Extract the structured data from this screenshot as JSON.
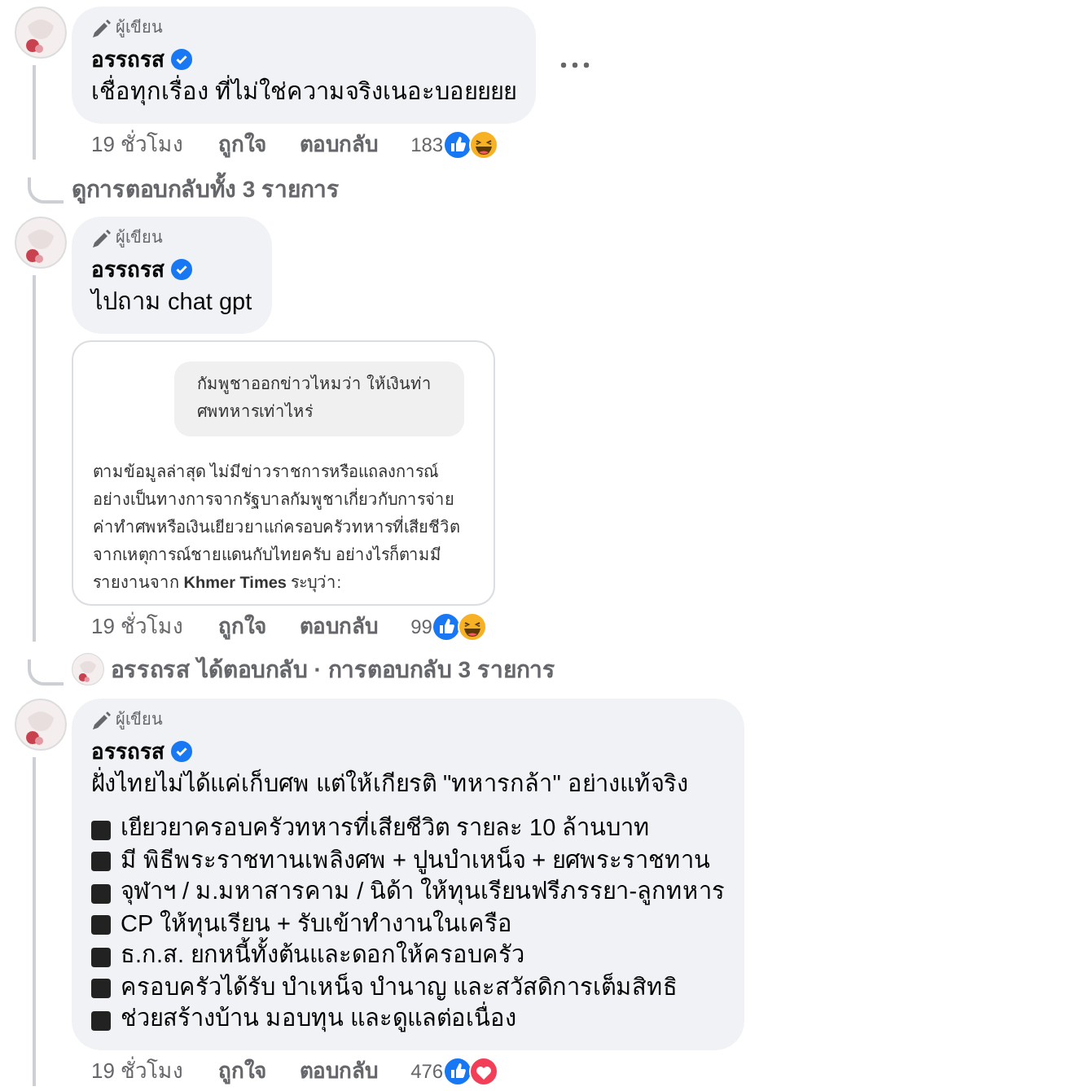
{
  "comments": [
    {
      "badge": "ผู้เขียน",
      "author": "อรรถรส",
      "verified": true,
      "text": "เชื่อทุกเรื่อง ที่ไม่ใช่ความจริงเนอะบอยยยย",
      "more_menu": true,
      "time": "19 ชั่วโมง",
      "like": "ถูกใจ",
      "reply": "ตอบกลับ",
      "reaction_count": "183",
      "reactions": [
        {
          "kind": "like"
        },
        {
          "kind": "haha"
        }
      ],
      "thread": {
        "kind": "link",
        "text": "ดูการตอบกลับทั้ง 3 รายการ"
      }
    },
    {
      "badge": "ผู้เขียน",
      "author": "อรรถรส",
      "verified": true,
      "text": "ไปถาม chat gpt",
      "attachment": {
        "prompt": "กัมพูชาออกข่าวไหมว่า ให้เงินท่าศพทหารเท่าไหร่",
        "answer": "ตามข้อมูลล่าสุด ไม่มีข่าวราชการหรือแถลงการณ์อย่างเป็นทางการจากรัฐบาลกัมพูชาเกี่ยวกับการจ่ายค่าทำศพหรือเงินเยียวยาแก่ครอบครัวทหารที่เสียชีวิตจากเหตุการณ์ชายแดนกับไทยครับ อย่างไรก็ตามมีรายงานจาก **Khmer Times** ระบุว่า:"
      },
      "time": "19 ชั่วโมง",
      "like": "ถูกใจ",
      "reply": "ตอบกลับ",
      "reaction_count": "99",
      "reactions": [
        {
          "kind": "like"
        },
        {
          "kind": "haha"
        }
      ],
      "thread": {
        "kind": "summary",
        "text": "อรรถรส ได้ตอบกลับ · การตอบกลับ 3 รายการ"
      }
    },
    {
      "badge": "ผู้เขียน",
      "author": "อรรถรส",
      "verified": true,
      "text": "ฝั่งไทยไม่ได้แค่เก็บศพ แต่ให้เกียรติ \"ทหารกล้า\" อย่างแท้จริง",
      "items": [
        "เยียวยาครอบครัวทหารที่เสียชีวิต รายละ 10 ล้านบาท",
        "มี พิธีพระราชทานเพลิงศพ + ปูนบำเหน็จ + ยศพระราชทาน",
        "จุฬาฯ / ม.มหาสารคาม / นิด้า ให้ทุนเรียนฟรีภรรยา-ลูกทหาร",
        "CP ให้ทุนเรียน + รับเข้าทำงานในเครือ",
        "ธ.ก.ส. ยกหนี้ทั้งต้นและดอกให้ครอบครัว",
        "ครอบครัวได้รับ บำเหน็จ บำนาญ และสวัสดิการเต็มสิทธิ",
        "ช่วยสร้างบ้าน มอบทุน และดูแลต่อเนื่อง"
      ],
      "time": "19 ชั่วโมง",
      "like": "ถูกใจ",
      "reply": "ตอบกลับ",
      "reaction_count": "476",
      "reactions": [
        {
          "kind": "like"
        },
        {
          "kind": "love"
        }
      ]
    }
  ]
}
